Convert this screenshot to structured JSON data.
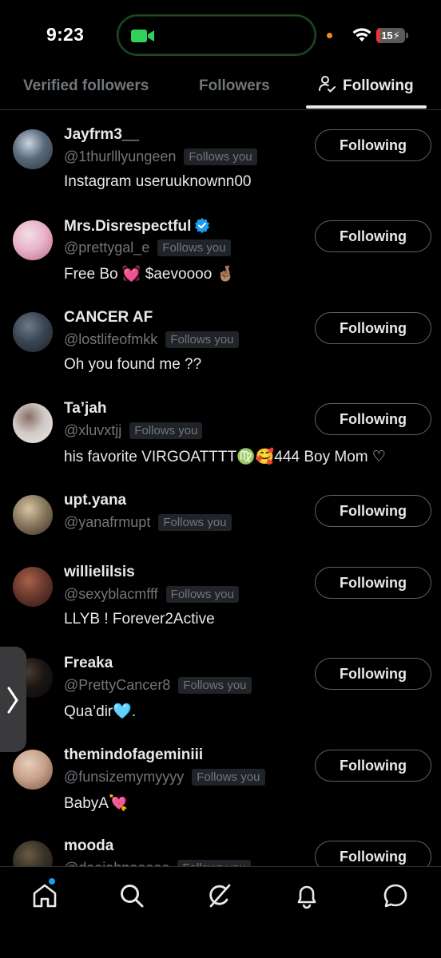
{
  "status": {
    "time": "9:23",
    "battery": "15"
  },
  "tabs": [
    {
      "label": "Verified followers"
    },
    {
      "label": "Followers"
    },
    {
      "label": "Following"
    }
  ],
  "users": [
    {
      "name": "Jayfrm3__",
      "handle": "@1thurlllyungeen",
      "follows": "Follows you",
      "bio": "Instagram useruuknownn00",
      "button": "Following",
      "colors": [
        "#5a6a7a",
        "#c9d4e0",
        "#2b3440"
      ]
    },
    {
      "name": "Mrs.Disrespectful",
      "handle": "@prettygal_e",
      "follows": "Follows you",
      "bio": "Free Bo 💓 $aevoooo 🤞🏽",
      "button": "Following",
      "verified": true,
      "colors": [
        "#e8b4c8",
        "#f2dfe6",
        "#b86a84"
      ]
    },
    {
      "name": "CANCER AF",
      "handle": "@lostlifeofmkk",
      "follows": "Follows you",
      "bio": "Oh you found me ??",
      "button": "Following",
      "colors": [
        "#3b4652",
        "#6d7c88",
        "#1c232a"
      ]
    },
    {
      "name": "Ta’jah",
      "handle": "@xluvxtjj",
      "follows": "Follows you",
      "bio": "his favorite VIRGOATTTT♍️🥰444 Boy Mom ♡",
      "button": "Following",
      "colors": [
        "#cfc8c4",
        "#8a6f66",
        "#efe9e6"
      ]
    },
    {
      "name": "upt.yana",
      "handle": "@yanafrmupt",
      "follows": "Follows you",
      "bio": "",
      "button": "Following",
      "colors": [
        "#8a7a60",
        "#d8c6a2",
        "#3a2f22"
      ]
    },
    {
      "name": "willielilsis",
      "handle": "@sexyblacmfff",
      "follows": "Follows you",
      "bio": "LLYB ! Forever2Active",
      "button": "Following",
      "colors": [
        "#6a3a2e",
        "#a8604a",
        "#2a1612"
      ]
    },
    {
      "name": "Freaka",
      "handle": "@PrettyCancer8",
      "follows": "Follows you",
      "bio": "Qua’dir🩵.",
      "button": "Following",
      "colors": [
        "#1a1614",
        "#4a3a30",
        "#0a0808"
      ]
    },
    {
      "name": "themindofageminiii",
      "handle": "@funsizemymyyyy",
      "follows": "Follows you",
      "bio": "BabyA💘",
      "button": "Following",
      "colors": [
        "#c8a28a",
        "#e6cdbb",
        "#7a5040"
      ]
    },
    {
      "name": "mooda",
      "handle": "@daejahnaeeee",
      "follows": "Follows you",
      "bio": "",
      "button": "Following",
      "colors": [
        "#3a3228",
        "#6a5a44",
        "#1a160f"
      ]
    }
  ],
  "nav": [
    {
      "icon": "home-icon"
    },
    {
      "icon": "search-icon"
    },
    {
      "icon": "grok-icon"
    },
    {
      "icon": "notifications-icon"
    },
    {
      "icon": "messages-icon"
    }
  ]
}
